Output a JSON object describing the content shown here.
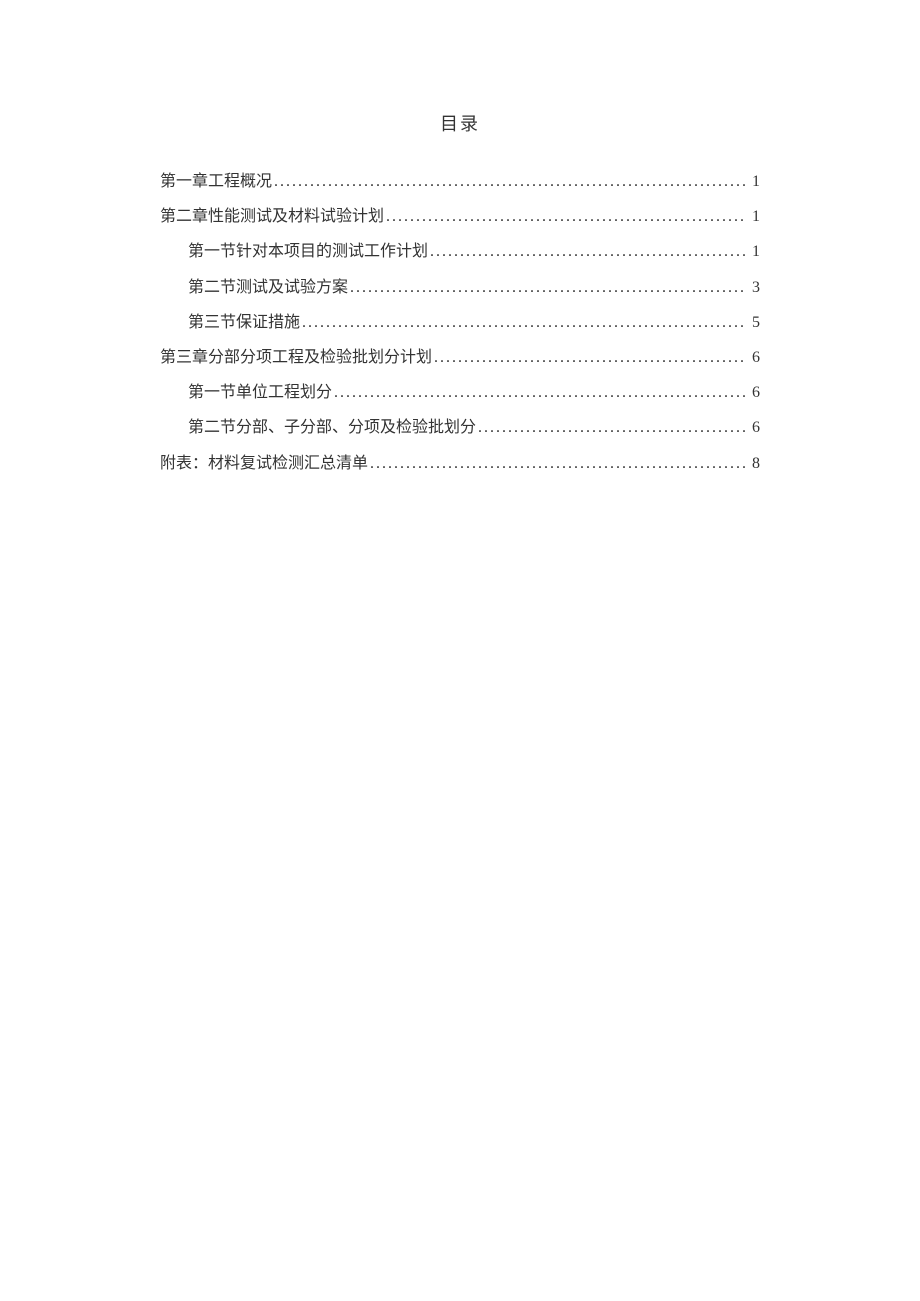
{
  "title": "目录",
  "entries": [
    {
      "level": 1,
      "label": "第一章工程概况",
      "page": "1"
    },
    {
      "level": 1,
      "label": "第二章性能测试及材料试验计划",
      "page": "1"
    },
    {
      "level": 2,
      "label": "第一节针对本项目的测试工作计划",
      "page": "1"
    },
    {
      "level": 2,
      "label": "第二节测试及试验方案",
      "page": "3"
    },
    {
      "level": 2,
      "label": "第三节保证措施",
      "page": "5"
    },
    {
      "level": 1,
      "label": "第三章分部分项工程及检验批划分计划",
      "page": "6"
    },
    {
      "level": 2,
      "label": "第一节单位工程划分",
      "page": "6"
    },
    {
      "level": 2,
      "label": "第二节分部、子分部、分项及检验批划分",
      "page": "6"
    },
    {
      "level": 1,
      "label": "附表：材料复试检测汇总清单",
      "page": "8"
    }
  ]
}
